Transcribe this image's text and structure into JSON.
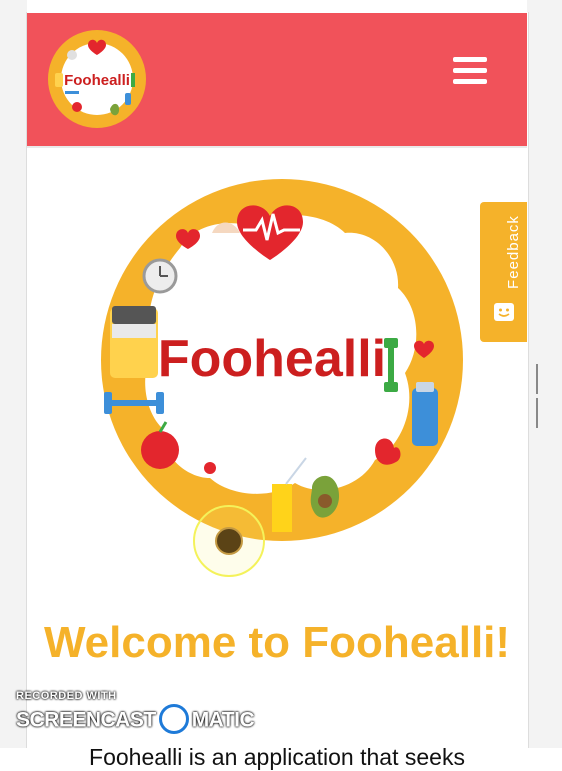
{
  "header": {
    "logo_text": "Foohealli",
    "menu_icon": "hamburger-icon"
  },
  "hero": {
    "logo_text": "Foohealli"
  },
  "feedback": {
    "label": "Feedback",
    "icon": "smiley-icon"
  },
  "main": {
    "welcome_heading": "Welcome to Foohealli!",
    "intro_text": "Foohealli is an application that seeks"
  },
  "watermark": {
    "line1": "RECORDED WITH",
    "line2_left": "SCREENCAST",
    "line2_right": "MATIC"
  },
  "colors": {
    "header_bg": "#f1525a",
    "accent_orange": "#f5b22a",
    "brand_red": "#cc1f1f"
  }
}
